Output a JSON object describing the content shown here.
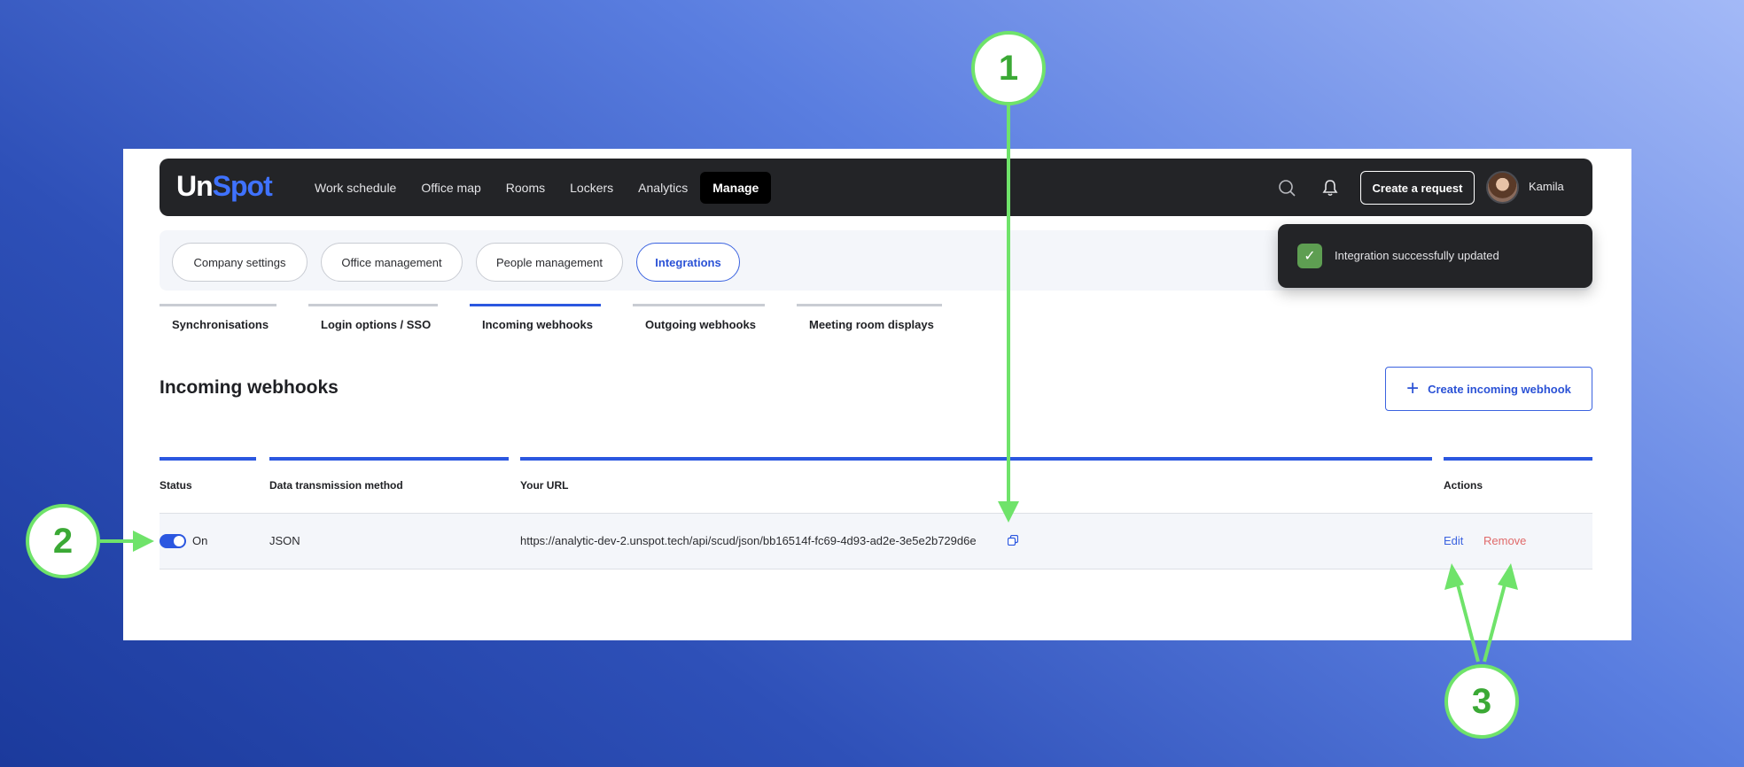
{
  "app": {
    "logo_part1": "Un",
    "logo_part2": "Spot",
    "nav": [
      "Work schedule",
      "Office map",
      "Rooms",
      "Lockers",
      "Analytics",
      "Manage"
    ],
    "active_nav": "Manage",
    "create_request": "Create a request",
    "user_name": "Kamila"
  },
  "sections": [
    "Company settings",
    "Office management",
    "People management",
    "Integrations"
  ],
  "active_section": "Integrations",
  "toast": {
    "message": "Integration successfully updated"
  },
  "subtabs": [
    "Synchronisations",
    "Login options / SSO",
    "Incoming webhooks",
    "Outgoing webhooks",
    "Meeting room displays"
  ],
  "active_subtab": "Incoming webhooks",
  "page": {
    "title": "Incoming webhooks",
    "create_button": "Create incoming webhook"
  },
  "table": {
    "headers": [
      "Status",
      "Data transmission method",
      "Your URL",
      "Actions"
    ],
    "row": {
      "status": "On",
      "method": "JSON",
      "url": "https://analytic-dev-2.unspot.tech/api/scud/json/bb16514f-fc69-4d93-ad2e-3e5e2b729d6e",
      "edit": "Edit",
      "remove": "Remove"
    }
  },
  "annotations": [
    "1",
    "2",
    "3"
  ],
  "colors": {
    "accent": "#2b57e0",
    "annotation": "#6fe36a",
    "remove": "#e06a6a"
  }
}
